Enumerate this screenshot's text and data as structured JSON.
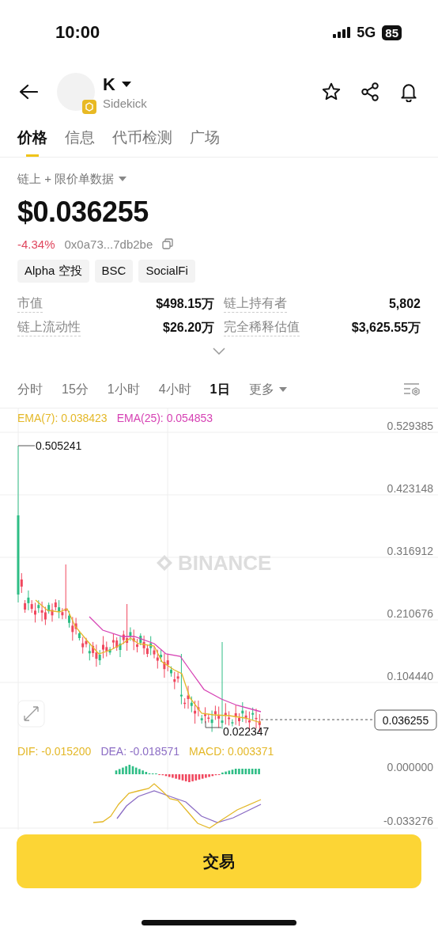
{
  "status_bar": {
    "time": "10:00",
    "network": "5G",
    "battery": "85"
  },
  "header": {
    "symbol": "K",
    "name": "Sidekick"
  },
  "tabs": [
    {
      "label": "价格",
      "selected": true
    },
    {
      "label": "信息",
      "selected": false
    },
    {
      "label": "代币检测",
      "selected": false
    },
    {
      "label": "广场",
      "selected": false
    }
  ],
  "data_source": "链上 + 限价单数据",
  "price": "$0.036255",
  "change": "-4.34%",
  "contract": "0x0a73...7db2be",
  "tags": [
    "Alpha 空投",
    "BSC",
    "SocialFi"
  ],
  "stats": [
    {
      "label": "市值",
      "value": "$498.15万"
    },
    {
      "label": "链上持有者",
      "value": "5,802"
    },
    {
      "label": "链上流动性",
      "value": "$26.20万"
    },
    {
      "label": "完全稀释估值",
      "value": "$3,625.55万"
    }
  ],
  "intervals": [
    {
      "label": "分时",
      "selected": false
    },
    {
      "label": "15分",
      "selected": false
    },
    {
      "label": "1小时",
      "selected": false
    },
    {
      "label": "4小时",
      "selected": false
    },
    {
      "label": "1日",
      "selected": true
    }
  ],
  "more": "更多",
  "chart": {
    "legend": [
      {
        "text": "EMA(7): 0.038423",
        "color": "#e4b828"
      },
      {
        "text": "EMA(25): 0.054853",
        "color": "#d642b4"
      }
    ],
    "y_labels": [
      "0.529385",
      "0.423148",
      "0.316912",
      "0.210676",
      "0.104440"
    ],
    "high_label": "0.505241",
    "low_label": "0.022347",
    "last_price": "0.036255",
    "watermark": "BINANCE"
  },
  "macd": {
    "legend": [
      {
        "text": "DIF: -0.015200",
        "color": "#e4b828"
      },
      {
        "text": "DEA: -0.018571",
        "color": "#8b6cc4"
      },
      {
        "text": "MACD: 0.003371",
        "color": "#e4b828"
      }
    ],
    "y_labels": [
      "0.000000",
      "-0.033276"
    ]
  },
  "trade_button": "交易"
}
